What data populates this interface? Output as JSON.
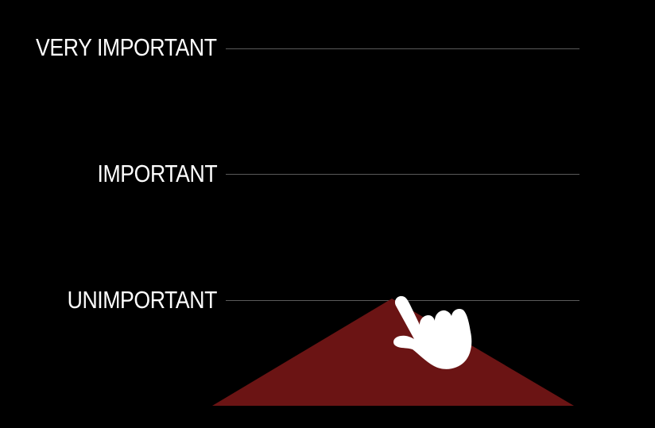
{
  "levels": {
    "very_important": "VERY IMPORTANT",
    "important": "IMPORTANT",
    "unimportant": "UNIMPORTANT"
  },
  "colors": {
    "background": "#000000",
    "text": "#ffffff",
    "guide_line": "#5a5a5a",
    "triangle_fill": "#6b1414",
    "hand_fill": "#ffffff"
  },
  "icons": {
    "pointer": "pointing-hand-icon"
  }
}
